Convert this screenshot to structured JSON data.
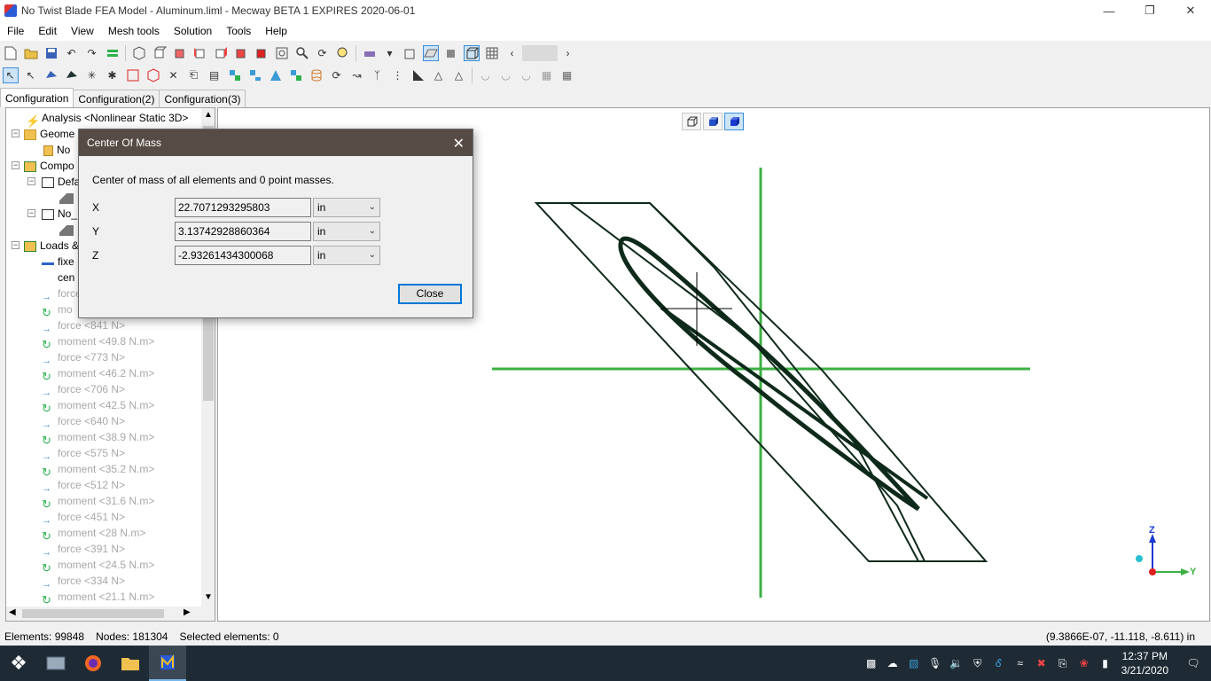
{
  "window": {
    "title": "No Twist Blade FEA Model - Aluminum.liml - Mecway BETA 1 EXPIRES 2020-06-01"
  },
  "menu": [
    "File",
    "Edit",
    "View",
    "Mesh tools",
    "Solution",
    "Tools",
    "Help"
  ],
  "tabs": [
    "Configuration",
    "Configuration(2)",
    "Configuration(3)"
  ],
  "tree": {
    "analysis": "Analysis <Nonlinear Static 3D>",
    "geometry": "Geome",
    "geometry_child": "No",
    "components": "Compo",
    "default": "Defa",
    "no_item": "No_",
    "loads": "Loads &",
    "fixed": "fixe",
    "center": "cen",
    "faded_force": "force",
    "faded_moment": "mo",
    "loads_list": [
      {
        "kind": "force",
        "label": "force <841 N>"
      },
      {
        "kind": "moment",
        "label": "moment <49.8 N.m>"
      },
      {
        "kind": "force",
        "label": "force <773 N>"
      },
      {
        "kind": "moment",
        "label": "moment <46.2 N.m>"
      },
      {
        "kind": "force",
        "label": "force <706 N>"
      },
      {
        "kind": "moment",
        "label": "moment <42.5 N.m>"
      },
      {
        "kind": "force",
        "label": "force <640 N>"
      },
      {
        "kind": "moment",
        "label": "moment <38.9 N.m>"
      },
      {
        "kind": "force",
        "label": "force <575 N>"
      },
      {
        "kind": "moment",
        "label": "moment <35.2 N.m>"
      },
      {
        "kind": "force",
        "label": "force <512 N>"
      },
      {
        "kind": "moment",
        "label": "moment <31.6 N.m>"
      },
      {
        "kind": "force",
        "label": "force <451 N>"
      },
      {
        "kind": "moment",
        "label": "moment <28 N.m>"
      },
      {
        "kind": "force",
        "label": "force <391 N>"
      },
      {
        "kind": "moment",
        "label": "moment <24.5 N.m>"
      },
      {
        "kind": "force",
        "label": "force <334 N>"
      },
      {
        "kind": "moment",
        "label": "moment <21.1 N.m>"
      }
    ]
  },
  "dialog": {
    "title": "Center Of Mass",
    "message": "Center of mass of all elements and 0 point masses.",
    "rows": [
      {
        "label": "X",
        "value": "22.7071293295803",
        "unit": "in"
      },
      {
        "label": "Y",
        "value": "3.13742928860364",
        "unit": "in"
      },
      {
        "label": "Z",
        "value": "-2.93261434300068",
        "unit": "in"
      }
    ],
    "close_label": "Close"
  },
  "axes": {
    "z": "Z",
    "y": "Y"
  },
  "status": {
    "elements": "Elements: 99848",
    "nodes": "Nodes: 181304",
    "selected": "Selected elements: 0",
    "coords": "(9.3866E-07, -11.118, -8.611) in"
  },
  "clock": {
    "time": "12:37 PM",
    "date": "3/21/2020"
  },
  "colors": {
    "model_line": "#0e2a1a",
    "axis_green": "#3cb043",
    "dialog_title": "#564c45"
  }
}
